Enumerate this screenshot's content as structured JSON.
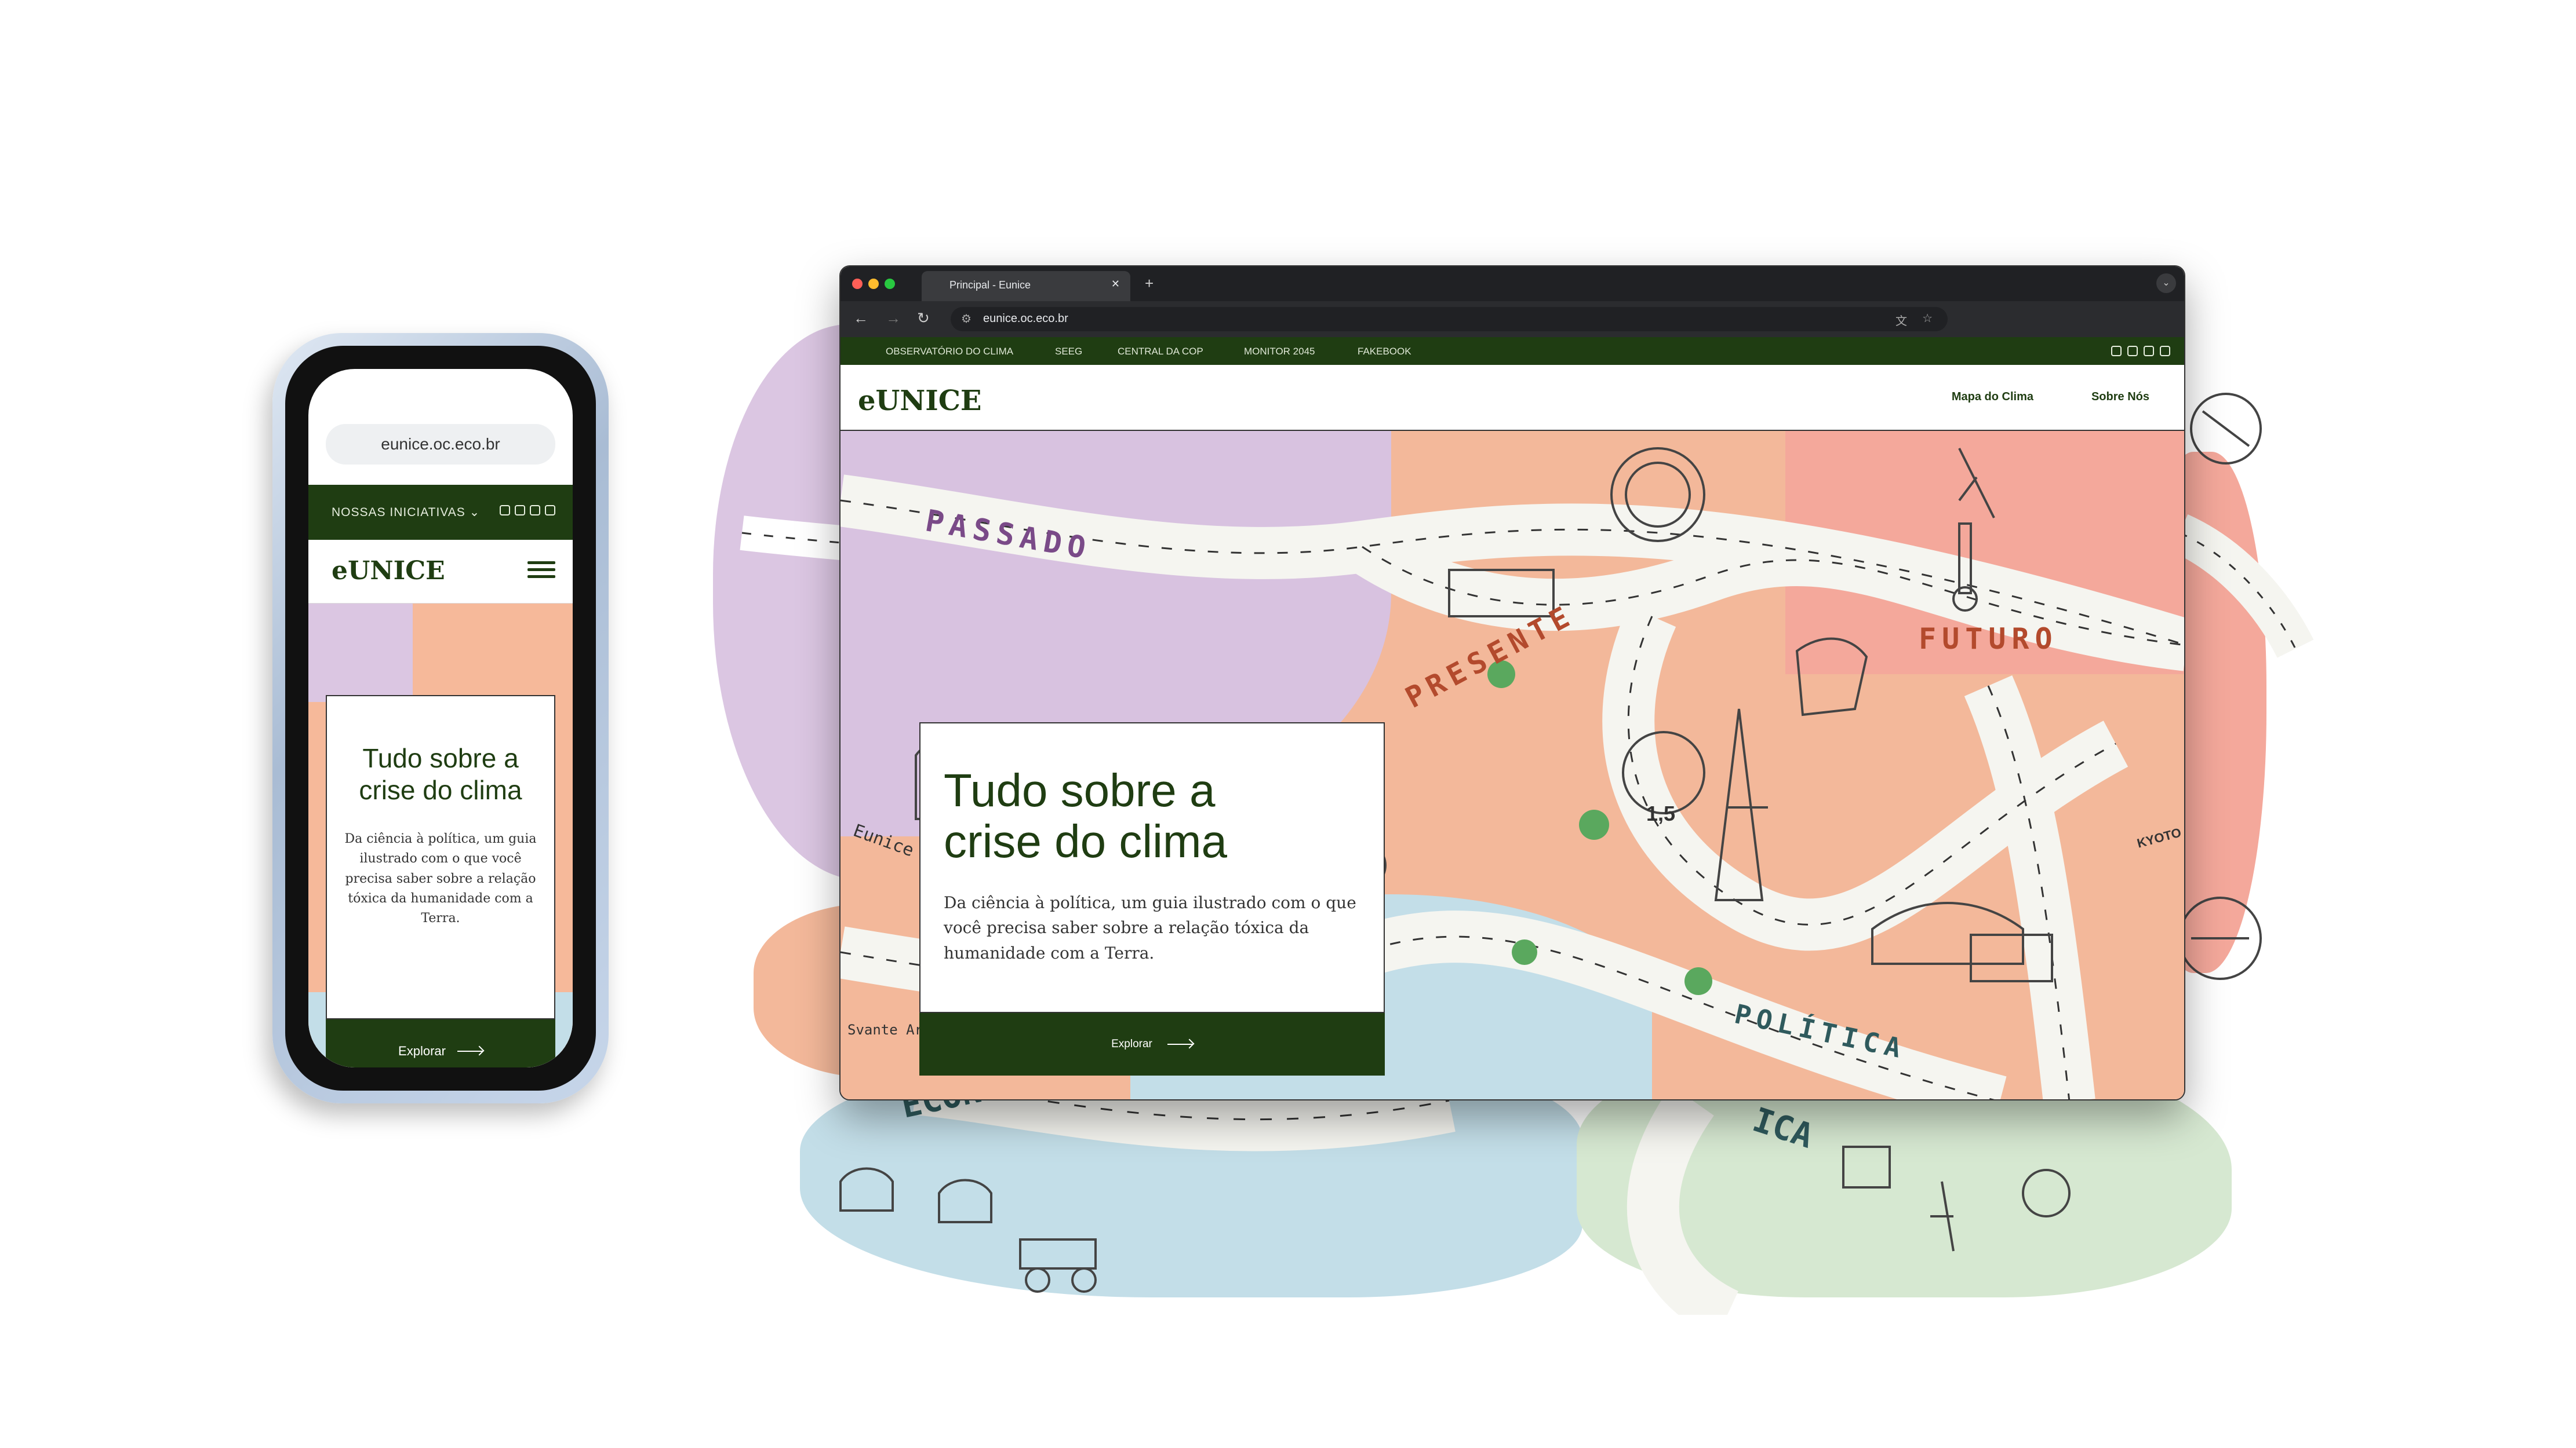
{
  "phone": {
    "url": "eunice.oc.eco.br",
    "initiatives_menu": "NOSSAS INICIATIVAS ⌄",
    "logo": "eUNICE",
    "hero_title": "Tudo sobre a crise do clima",
    "hero_body": "Da ciência à política, um guia ilustrado com o que você precisa saber sobre a relação tóxica da humanidade com a Terra.",
    "cta": "Explorar"
  },
  "browser": {
    "tab_title": "Principal - Eunice",
    "url": "eunice.oc.eco.br",
    "top_nav": [
      "OBSERVATÓRIO DO CLIMA",
      "SEEG",
      "CENTRAL DA COP",
      "MONITOR 2045",
      "FAKEBOOK"
    ],
    "logo": "eUNICE",
    "menu": [
      "Mapa do Clima",
      "Sobre Nós"
    ],
    "hero_title": "Tudo sobre a crise do clima",
    "hero_body": "Da ciência à política, um guia ilustrado com  o que você precisa saber sobre a relação tóxica  da humanidade com a Terra.",
    "cta": "Explorar"
  },
  "map_labels": {
    "passado": "PASSADO",
    "presente": "PRESENTE",
    "futuro": "FUTURO",
    "economia": "ECONOMIA",
    "politica": "POLÍTICA",
    "eunice": "Eunice",
    "arrhenius": "Svante Arrhenius",
    "kyoto": "KYOTO",
    "temp": "1,5"
  },
  "colors": {
    "brand_green": "#1f3d12",
    "peach": "#f3b89a",
    "lavender": "#d8c2e0",
    "sky": "#bcdde7",
    "sage": "#d7e8d2",
    "salmon": "#f4a89b"
  }
}
